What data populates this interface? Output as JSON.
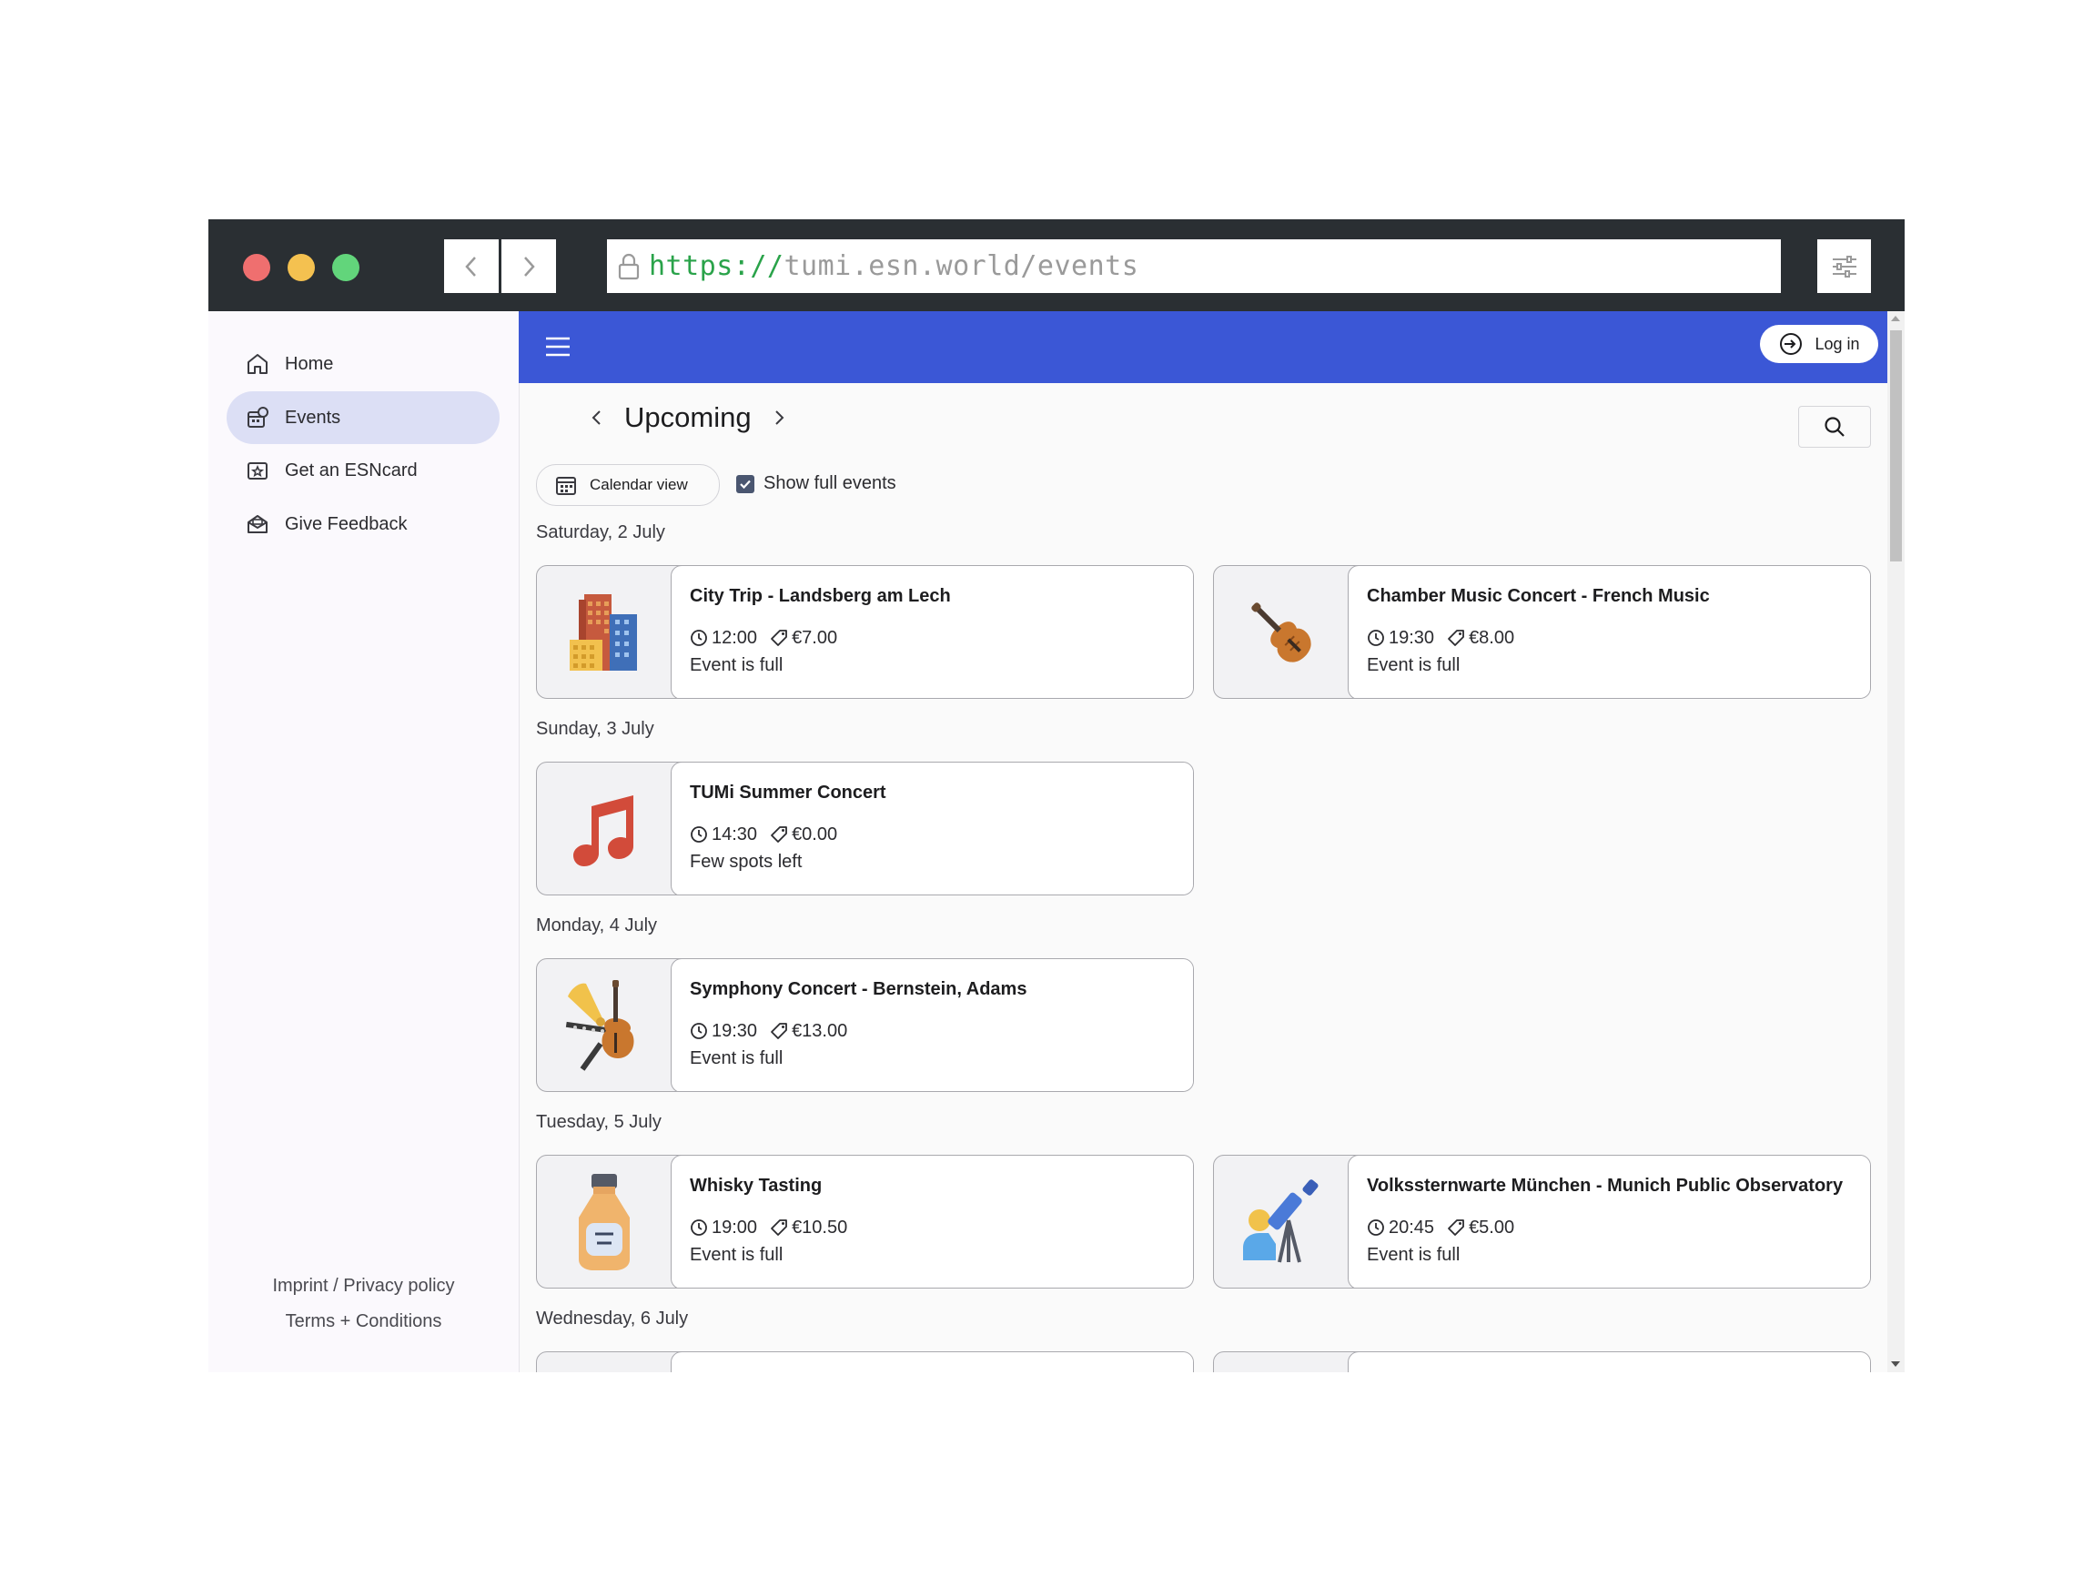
{
  "browser": {
    "url_scheme": "https://",
    "url_host": "tumi.esn.world/events"
  },
  "sidebar": {
    "items": [
      {
        "label": "Home",
        "icon": "home-icon"
      },
      {
        "label": "Events",
        "icon": "events-icon",
        "active": true
      },
      {
        "label": "Get an ESNcard",
        "icon": "esncard-icon"
      },
      {
        "label": "Give Feedback",
        "icon": "feedback-icon"
      }
    ],
    "footer": {
      "imprint": "Imprint / Privacy policy",
      "terms": "Terms + Conditions"
    }
  },
  "topbar": {
    "login_label": "Log in",
    "accent": "#3b57d6"
  },
  "page": {
    "title": "Upcoming",
    "calendar_label": "Calendar view",
    "show_full_label": "Show full events",
    "show_full_checked": true
  },
  "days": [
    {
      "label": "Saturday, 2 July",
      "events": [
        {
          "title": "City Trip - Landsberg am Lech",
          "time": "12:00",
          "price": "€7.00",
          "status": "Event is full",
          "icon": "city-buildings-icon"
        },
        {
          "title": "Chamber Music Concert - French Music",
          "time": "19:30",
          "price": "€8.00",
          "status": "Event is full",
          "icon": "violin-icon"
        }
      ]
    },
    {
      "label": "Sunday, 3 July",
      "events": [
        {
          "title": "TUMi Summer Concert",
          "time": "14:30",
          "price": "€0.00",
          "status": "Few spots left",
          "icon": "music-note-icon"
        }
      ]
    },
    {
      "label": "Monday, 4 July",
      "events": [
        {
          "title": "Symphony Concert - Bernstein, Adams",
          "time": "19:30",
          "price": "€13.00",
          "status": "Event is full",
          "icon": "orchestra-instruments-icon"
        }
      ]
    },
    {
      "label": "Tuesday, 5 July",
      "events": [
        {
          "title": "Whisky Tasting",
          "time": "19:00",
          "price": "€10.50",
          "status": "Event is full",
          "icon": "whisky-bottle-icon"
        },
        {
          "title": "Volkssternwarte München - Munich Public Observatory",
          "time": "20:45",
          "price": "€5.00",
          "status": "Event is full",
          "icon": "telescope-icon"
        }
      ]
    },
    {
      "label": "Wednesday, 6 July",
      "events": []
    }
  ]
}
